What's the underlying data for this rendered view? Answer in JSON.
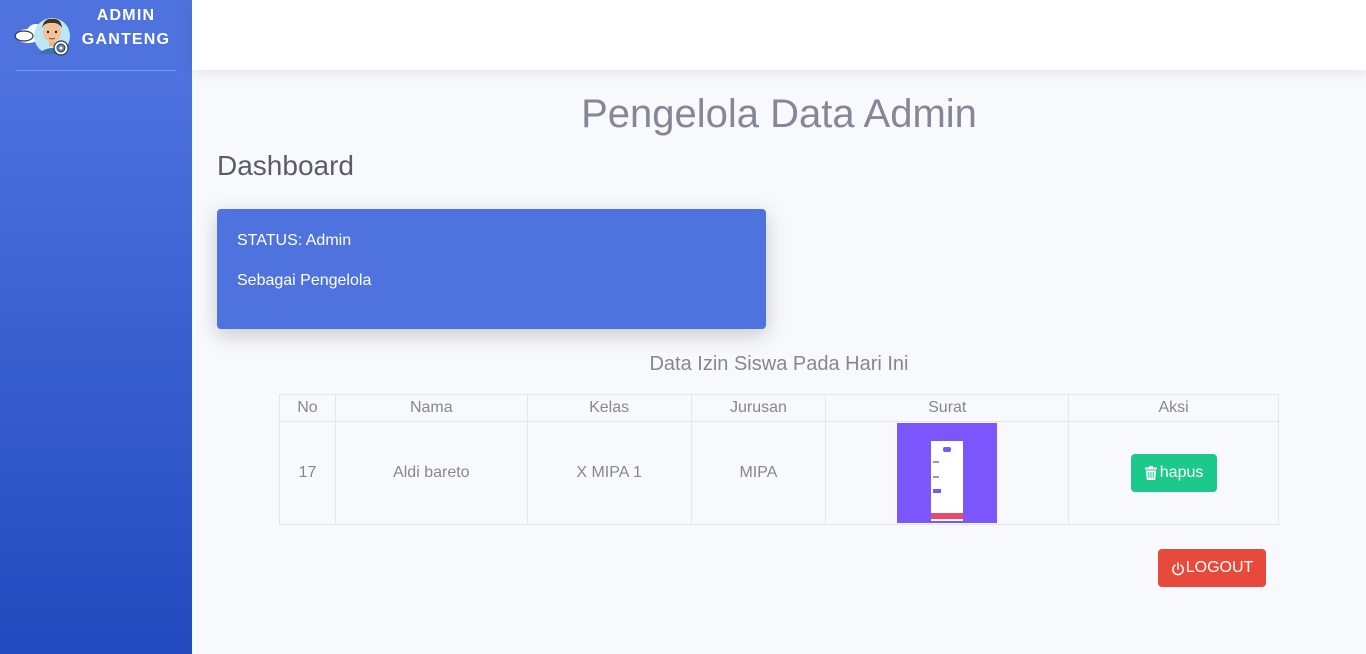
{
  "sidebar": {
    "brand_text": "ADMIN GANTENG",
    "logo_icon": "admin-avatar-with-cloud-and-gear"
  },
  "page": {
    "heading": "Pengelola Data Admin",
    "dashboard_title": "Dashboard"
  },
  "status_card": {
    "status_line": "STATUS: Admin",
    "role_line": "Sebagai Pengelola",
    "color": "#4e73df"
  },
  "table": {
    "caption": "Data Izin Siswa Pada Hari Ini",
    "headers": [
      "No",
      "Nama",
      "Kelas",
      "Jurusan",
      "Surat",
      "Aksi"
    ],
    "rows": [
      {
        "no": "17",
        "nama": "Aldi bareto",
        "kelas": "X MIPA 1",
        "jurusan": "MIPA",
        "surat_thumbnail": "letter-image-thumbnail",
        "action_label": "hapus",
        "action_icon": "trash-icon"
      }
    ]
  },
  "logout": {
    "label": "LOGOUT",
    "icon": "power-icon",
    "color": "#e74a3b"
  },
  "colors": {
    "sidebar_gradient_top": "#4e73df",
    "sidebar_gradient_bottom": "#224abe",
    "success": "#1cc88a",
    "text_muted": "#858796"
  }
}
